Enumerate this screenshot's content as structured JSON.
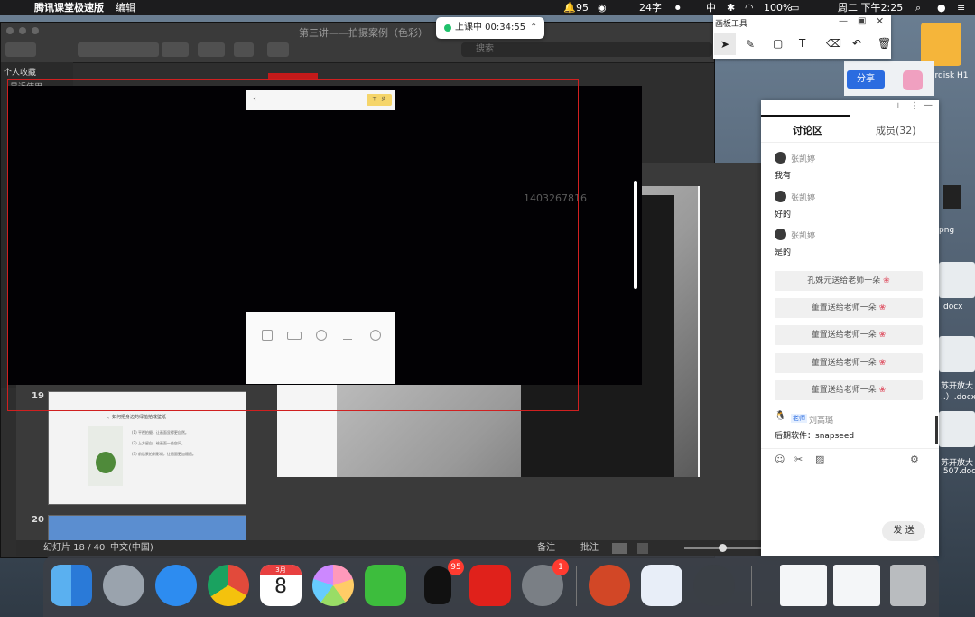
{
  "menubar": {
    "app_name": "腾讯课堂极速版",
    "edit_menu": "编辑",
    "qq_count": "95",
    "input_method": "中",
    "temp": "24字",
    "battery": "100%",
    "clock": "周二 下午2:25"
  },
  "back_window": {
    "title": "第三讲——拍摄案例（色彩）",
    "search_placeholder": "搜索",
    "sidebar_header": "个人收藏",
    "sidebar_item": "最近使用"
  },
  "thumbs": [
    {
      "number": "19",
      "title": "一、如何把身边的绿植拍成壁纸",
      "lines": [
        "(1) 平视拍摄，让画面显得更自然。",
        "(2) 上方留白，给画面一些空间。",
        "(3) 前后景拍到影调，让画面更加通透。"
      ]
    },
    {
      "number": "20"
    }
  ],
  "statusbar": {
    "slide_counter": "幻灯片 18 / 40",
    "language": "中文(中国)",
    "notes": "备注",
    "comments": "批注"
  },
  "video": {
    "watermark": "1403267816",
    "phone_next": "下一步"
  },
  "class_pill": {
    "status": "上课中 00:34:55"
  },
  "board": {
    "title": "画板工具"
  },
  "panel": {
    "tab_discussion": "讨论区",
    "tab_members": "成员(32)",
    "messages": [
      {
        "name": "张凯婷",
        "text": "我有"
      },
      {
        "name": "张凯婷",
        "text": "好的"
      },
      {
        "name": "张凯婷",
        "text": "是的"
      }
    ],
    "gifts": [
      "孔姝元送给老师一朵",
      "董置送给老师一朵",
      "董置送给老师一朵",
      "董置送给老师一朵",
      "董置送给老师一朵"
    ],
    "teacher_badge": "老师",
    "teacher_name": "刘高璐",
    "teacher_message": "后期软件：snapseed",
    "send_button": "发 送"
  },
  "desktop": {
    "share_button": "分享",
    "labels": [
      "ardisk H1",
      "png",
      "docx",
      "苏开放大",
      "..）.docx",
      "苏开放大",
      ".507.docx"
    ]
  },
  "dock": {
    "calendar_month": "3月",
    "calendar_day": "8",
    "qq_badge": "95",
    "settings_badge": "1"
  }
}
